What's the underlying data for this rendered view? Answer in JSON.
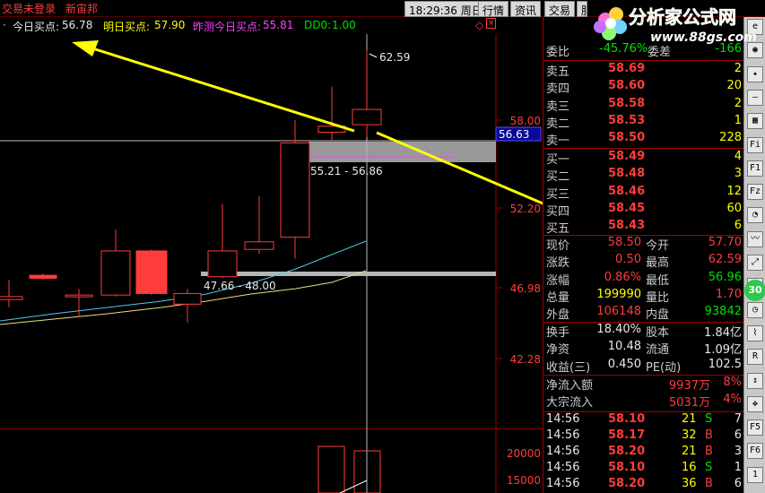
{
  "topbar": {
    "account_status": "交易未登录",
    "stock_name": "新宙邦",
    "time": "18:29:36",
    "weekday": "周日",
    "menu": [
      "行情",
      "资讯",
      "交易",
      "服务"
    ]
  },
  "watermark": {
    "title": "分析家公式网",
    "url": "www.88gs.com"
  },
  "indicator_line": {
    "today_buy_label": "今日买点:",
    "today_buy_value": "56.78",
    "tomorrow_buy_label": "明日买点:",
    "tomorrow_buy_value": "57.90",
    "yesterday_today_label": "昨测今日买点:",
    "yesterday_today_value": "55.81",
    "dd0_label": "DD0:",
    "dd0_value": "1.00"
  },
  "chart_data": {
    "type": "candlestick",
    "price_axis_ticks": [
      "58.00",
      "52.20",
      "46.98",
      "42.28"
    ],
    "volume_axis_ticks": [
      "20000",
      "15000"
    ],
    "crosshair_price": "56.63",
    "high_label": "62.59",
    "zone_upper_label": "55.21 - 56.86",
    "zone_lower_label": "47.66 - 48.00",
    "candles": [
      {
        "o": 46.2,
        "c": 46.4,
        "h": 47.5,
        "l": 45.7,
        "up": true
      },
      {
        "o": 47.8,
        "c": 47.6,
        "h": 47.9,
        "l": 47.5,
        "up": false
      },
      {
        "o": 46.4,
        "c": 46.5,
        "h": 46.9,
        "l": 45.1,
        "up": true
      },
      {
        "o": 46.5,
        "c": 49.4,
        "h": 50.8,
        "l": 46.4,
        "up": true
      },
      {
        "o": 49.4,
        "c": 46.6,
        "h": 49.5,
        "l": 46.5,
        "up": false
      },
      {
        "o": 45.9,
        "c": 46.6,
        "h": 46.9,
        "l": 44.7,
        "up": true
      },
      {
        "o": 47.7,
        "c": 49.4,
        "h": 52.5,
        "l": 47.6,
        "up": true
      },
      {
        "o": 49.5,
        "c": 50.0,
        "h": 53.0,
        "l": 49.2,
        "up": true
      },
      {
        "o": 50.3,
        "c": 56.5,
        "h": 58.0,
        "l": 48.9,
        "up": true
      },
      {
        "o": 57.2,
        "c": 57.6,
        "h": 60.2,
        "l": 56.6,
        "up": true
      },
      {
        "o": 57.7,
        "c": 58.7,
        "h": 62.59,
        "l": 56.9,
        "up": true
      }
    ]
  },
  "quote": {
    "weibi": {
      "label": "委比",
      "value": "-45.76%",
      "label2": "委差",
      "value2": "-166"
    },
    "asks": [
      {
        "label": "卖五",
        "price": "58.69",
        "vol": "2"
      },
      {
        "label": "卖四",
        "price": "58.60",
        "vol": "20"
      },
      {
        "label": "卖三",
        "price": "58.58",
        "vol": "2"
      },
      {
        "label": "卖二",
        "price": "58.53",
        "vol": "1"
      },
      {
        "label": "卖一",
        "price": "58.50",
        "vol": "228"
      }
    ],
    "bids": [
      {
        "label": "买一",
        "price": "58.49",
        "vol": "4"
      },
      {
        "label": "买二",
        "price": "58.48",
        "vol": "3"
      },
      {
        "label": "买三",
        "price": "58.46",
        "vol": "12"
      },
      {
        "label": "买四",
        "price": "58.45",
        "vol": "60"
      },
      {
        "label": "买五",
        "price": "58.43",
        "vol": "6"
      }
    ],
    "stats": [
      {
        "l1": "现价",
        "v1": "58.50",
        "l2": "今开",
        "v2": "57.70"
      },
      {
        "l1": "涨跌",
        "v1": "0.50",
        "l2": "最高",
        "v2": "62.59"
      },
      {
        "l1": "涨幅",
        "v1": "0.86%",
        "l2": "最低",
        "v2": "56.96"
      },
      {
        "l1": "总量",
        "v1": "199990",
        "l2": "量比",
        "v2": "1.70"
      },
      {
        "l1": "外盘",
        "v1": "106148",
        "l2": "内盘",
        "v2": "93842"
      }
    ],
    "fund": [
      {
        "l1": "换手",
        "v1": "18.40%",
        "l2": "股本",
        "v2": "1.84亿"
      },
      {
        "l1": "净资",
        "v1": "10.48",
        "l2": "流通",
        "v2": "1.09亿"
      },
      {
        "l1": "收益(三)",
        "v1": "0.450",
        "l2": "PE(动)",
        "v2": "102.5"
      }
    ],
    "flow": [
      {
        "label": "净流入额",
        "value": "9937万",
        "pct": "8%"
      },
      {
        "label": "大宗流入",
        "value": "5031万",
        "pct": "4%"
      }
    ],
    "ticks": [
      {
        "time": "14:56",
        "price": "58.10",
        "vol": "21",
        "side": "S",
        "n": "7"
      },
      {
        "time": "14:56",
        "price": "58.17",
        "vol": "32",
        "side": "B",
        "n": "6"
      },
      {
        "time": "14:56",
        "price": "58.20",
        "vol": "21",
        "side": "B",
        "n": "3"
      },
      {
        "time": "14:56",
        "price": "58.10",
        "vol": "16",
        "side": "S",
        "n": "1"
      },
      {
        "time": "14:56",
        "price": "58.20",
        "vol": "36",
        "side": "B",
        "n": "6"
      }
    ]
  },
  "icons": [
    "ie",
    "rk",
    "fq",
    "fin",
    "f10",
    "fq1",
    "fq2",
    "tend",
    "kline",
    "up",
    "down",
    "timer",
    "vol",
    "rsi",
    "reset",
    "move",
    "f5",
    "f6",
    "one"
  ],
  "sidebar_badge": "30"
}
